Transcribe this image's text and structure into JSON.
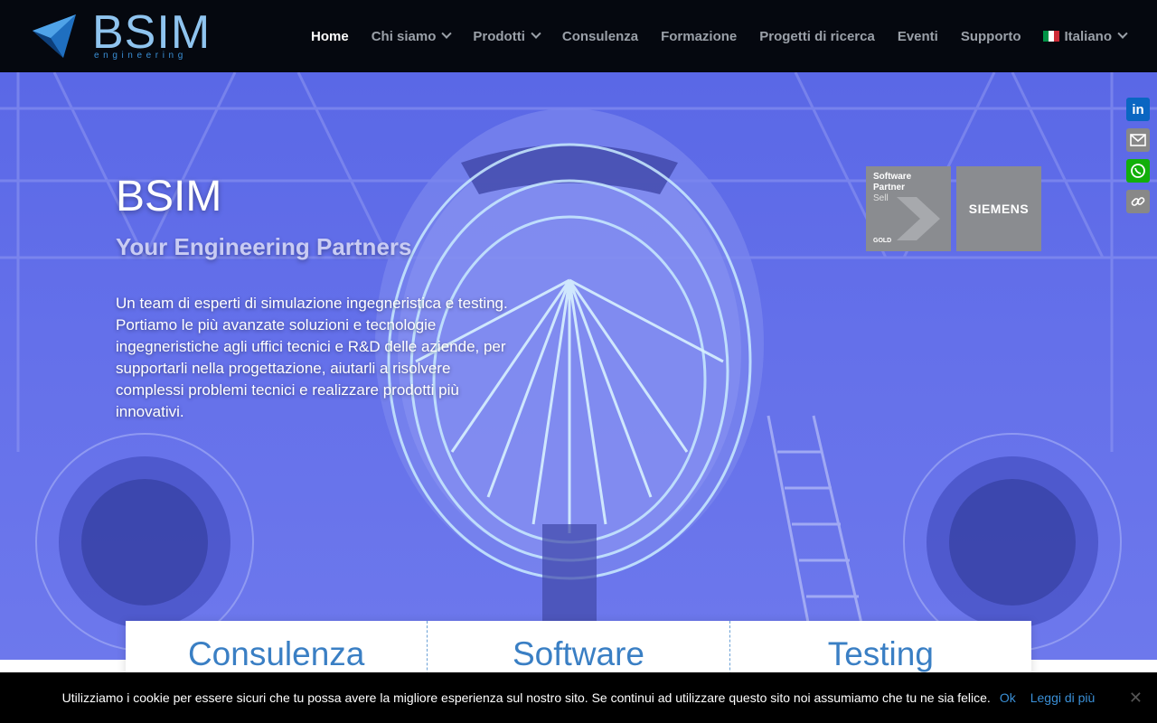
{
  "brand": {
    "name": "BSIM",
    "tagline": "engineering"
  },
  "nav": {
    "items": [
      {
        "label": "Home",
        "active": true,
        "dropdown": false
      },
      {
        "label": "Chi siamo",
        "active": false,
        "dropdown": true
      },
      {
        "label": "Prodotti",
        "active": false,
        "dropdown": true
      },
      {
        "label": "Consulenza",
        "active": false,
        "dropdown": false
      },
      {
        "label": "Formazione",
        "active": false,
        "dropdown": false
      },
      {
        "label": "Progetti di ricerca",
        "active": false,
        "dropdown": false
      },
      {
        "label": "Eventi",
        "active": false,
        "dropdown": false
      },
      {
        "label": "Supporto",
        "active": false,
        "dropdown": false
      }
    ],
    "language": "Italiano"
  },
  "hero": {
    "title": "BSIM",
    "subtitle": "Your Engineering Partners",
    "text": "Un team di esperti di simulazione ingegneristica e testing. Portiamo le più avanzate soluzioni e tecnologie ingegneristiche agli uffici tecnici e R&D delle aziende, per supportarli nella progettazione, aiutarli a risolvere complessi problemi tecnici e realizzare prodotti più innovativi."
  },
  "badges": {
    "partner_line1": "Software",
    "partner_line2": "Partner",
    "partner_line3": "Sell",
    "partner_level": "GOLD",
    "siemens": "SIEMENS"
  },
  "share": [
    {
      "icon": "linkedin-icon",
      "color": "#0a66c2"
    },
    {
      "icon": "email-icon",
      "color": "#888888"
    },
    {
      "icon": "whatsapp-icon",
      "color": "#12af0a"
    },
    {
      "icon": "copy-link-icon",
      "color": "#888888"
    }
  ],
  "cards": [
    "Consulenza",
    "Software",
    "Testing"
  ],
  "cookie": {
    "message": "Utilizziamo i cookie per essere sicuri che tu possa avere la migliore esperienza sul nostro sito. Se continui ad utilizzare questo sito noi assumiamo che tu ne sia felice.",
    "ok": "Ok",
    "more": "Leggi di più",
    "close": "✕"
  },
  "colors": {
    "header_bg": "#05080f",
    "hero_tint": "#5f6be8",
    "accent": "#3a7fc4",
    "cookie_link": "#3a8fd6"
  }
}
